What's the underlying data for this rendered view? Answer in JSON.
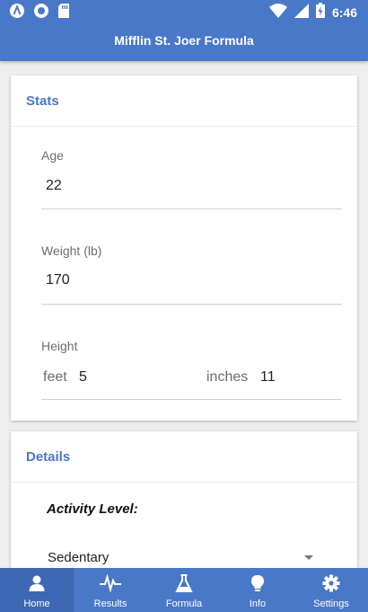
{
  "status_bar": {
    "time": "6:46",
    "icons": [
      "app-a-icon",
      "record-icon",
      "sd-card-icon",
      "wifi-icon",
      "signal-icon",
      "battery-charging-icon"
    ]
  },
  "header": {
    "title": "Mifflin St. Joer Formula"
  },
  "stats_card": {
    "title": "Stats",
    "age_label": "Age",
    "age_value": "22",
    "weight_label": "Weight (lb)",
    "weight_value": "170",
    "height_label": "Height",
    "feet_label": "feet",
    "feet_value": "5",
    "inches_label": "inches",
    "inches_value": "11"
  },
  "details_card": {
    "title": "Details",
    "activity_label": "Activity Level:",
    "activity_selected": "Sedentary"
  },
  "tabs": [
    {
      "label": "Home",
      "icon": "person-icon",
      "active": true
    },
    {
      "label": "Results",
      "icon": "pulse-icon",
      "active": false
    },
    {
      "label": "Formula",
      "icon": "flask-icon",
      "active": false
    },
    {
      "label": "Info",
      "icon": "lightbulb-icon",
      "active": false
    },
    {
      "label": "Settings",
      "icon": "gear-icon",
      "active": false
    }
  ],
  "colors": {
    "accent": "#4a78c8",
    "active_tab": "#3d68b3"
  }
}
